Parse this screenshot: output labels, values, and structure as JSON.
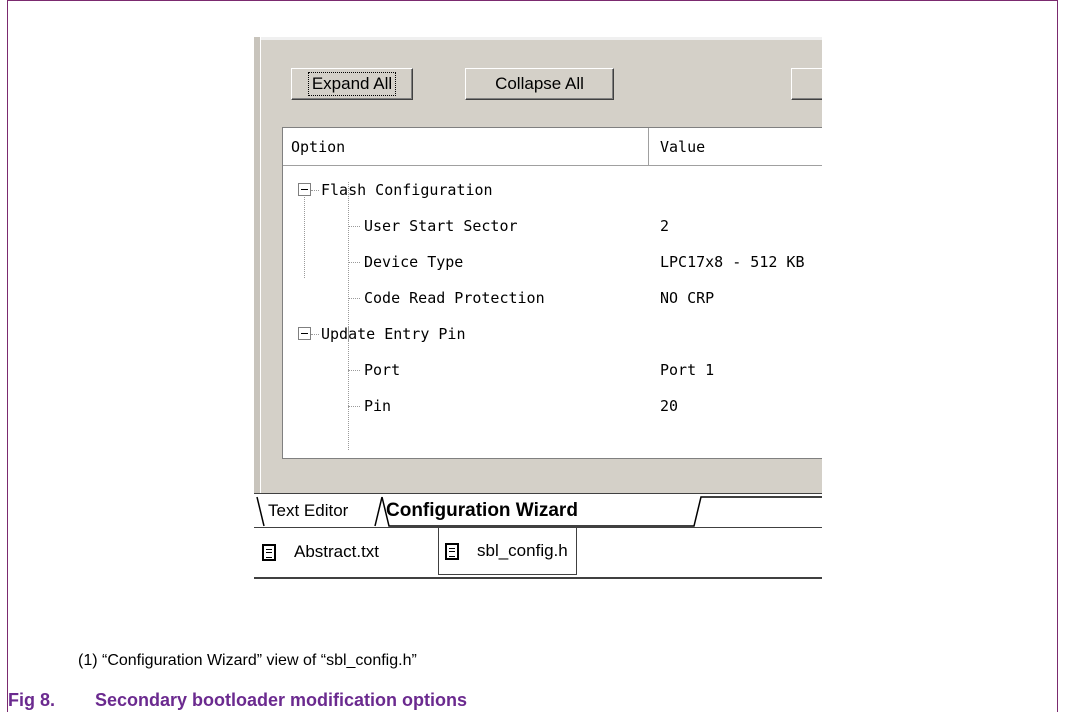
{
  "toolbar": {
    "expand_all": "Expand All",
    "collapse_all": "Collapse All"
  },
  "grid": {
    "columns": [
      "Option",
      "Value"
    ],
    "groups": [
      {
        "label": "Flash Configuration",
        "items": [
          {
            "label": "User Start Sector",
            "value": "2"
          },
          {
            "label": "Device Type",
            "value": "LPC17x8 - 512 KB"
          },
          {
            "label": "Code Read Protection",
            "value": "NO CRP"
          }
        ]
      },
      {
        "label": "Update Entry Pin",
        "items": [
          {
            "label": "Port",
            "value": "Port 1"
          },
          {
            "label": "Pin",
            "value": "20"
          }
        ]
      }
    ]
  },
  "editor_tabs": [
    "Text Editor",
    "Configuration Wizard"
  ],
  "file_tabs": [
    "Abstract.txt",
    "sbl_config.h"
  ],
  "caption": "(1)  “Configuration Wizard” view of “sbl_config.h”",
  "figure": {
    "number": "Fig 8.",
    "title": "Secondary bootloader modification options"
  },
  "colors": {
    "frame": "#7b2a6f",
    "figure_title": "#6b2a8f",
    "window_bg": "#d4d0c8"
  }
}
